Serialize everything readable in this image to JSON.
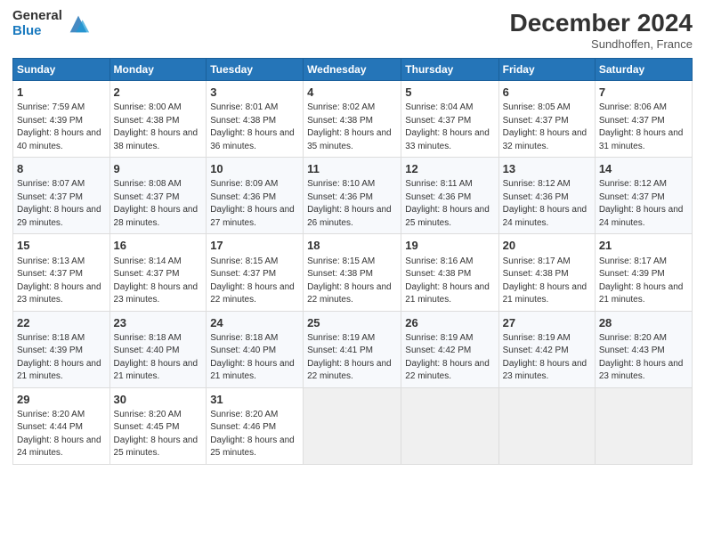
{
  "header": {
    "logo_general": "General",
    "logo_blue": "Blue",
    "month_title": "December 2024",
    "subtitle": "Sundhoffen, France"
  },
  "days_of_week": [
    "Sunday",
    "Monday",
    "Tuesday",
    "Wednesday",
    "Thursday",
    "Friday",
    "Saturday"
  ],
  "weeks": [
    [
      {
        "day": "1",
        "sunrise": "Sunrise: 7:59 AM",
        "sunset": "Sunset: 4:39 PM",
        "daylight": "Daylight: 8 hours and 40 minutes."
      },
      {
        "day": "2",
        "sunrise": "Sunrise: 8:00 AM",
        "sunset": "Sunset: 4:38 PM",
        "daylight": "Daylight: 8 hours and 38 minutes."
      },
      {
        "day": "3",
        "sunrise": "Sunrise: 8:01 AM",
        "sunset": "Sunset: 4:38 PM",
        "daylight": "Daylight: 8 hours and 36 minutes."
      },
      {
        "day": "4",
        "sunrise": "Sunrise: 8:02 AM",
        "sunset": "Sunset: 4:38 PM",
        "daylight": "Daylight: 8 hours and 35 minutes."
      },
      {
        "day": "5",
        "sunrise": "Sunrise: 8:04 AM",
        "sunset": "Sunset: 4:37 PM",
        "daylight": "Daylight: 8 hours and 33 minutes."
      },
      {
        "day": "6",
        "sunrise": "Sunrise: 8:05 AM",
        "sunset": "Sunset: 4:37 PM",
        "daylight": "Daylight: 8 hours and 32 minutes."
      },
      {
        "day": "7",
        "sunrise": "Sunrise: 8:06 AM",
        "sunset": "Sunset: 4:37 PM",
        "daylight": "Daylight: 8 hours and 31 minutes."
      }
    ],
    [
      {
        "day": "8",
        "sunrise": "Sunrise: 8:07 AM",
        "sunset": "Sunset: 4:37 PM",
        "daylight": "Daylight: 8 hours and 29 minutes."
      },
      {
        "day": "9",
        "sunrise": "Sunrise: 8:08 AM",
        "sunset": "Sunset: 4:37 PM",
        "daylight": "Daylight: 8 hours and 28 minutes."
      },
      {
        "day": "10",
        "sunrise": "Sunrise: 8:09 AM",
        "sunset": "Sunset: 4:36 PM",
        "daylight": "Daylight: 8 hours and 27 minutes."
      },
      {
        "day": "11",
        "sunrise": "Sunrise: 8:10 AM",
        "sunset": "Sunset: 4:36 PM",
        "daylight": "Daylight: 8 hours and 26 minutes."
      },
      {
        "day": "12",
        "sunrise": "Sunrise: 8:11 AM",
        "sunset": "Sunset: 4:36 PM",
        "daylight": "Daylight: 8 hours and 25 minutes."
      },
      {
        "day": "13",
        "sunrise": "Sunrise: 8:12 AM",
        "sunset": "Sunset: 4:36 PM",
        "daylight": "Daylight: 8 hours and 24 minutes."
      },
      {
        "day": "14",
        "sunrise": "Sunrise: 8:12 AM",
        "sunset": "Sunset: 4:37 PM",
        "daylight": "Daylight: 8 hours and 24 minutes."
      }
    ],
    [
      {
        "day": "15",
        "sunrise": "Sunrise: 8:13 AM",
        "sunset": "Sunset: 4:37 PM",
        "daylight": "Daylight: 8 hours and 23 minutes."
      },
      {
        "day": "16",
        "sunrise": "Sunrise: 8:14 AM",
        "sunset": "Sunset: 4:37 PM",
        "daylight": "Daylight: 8 hours and 23 minutes."
      },
      {
        "day": "17",
        "sunrise": "Sunrise: 8:15 AM",
        "sunset": "Sunset: 4:37 PM",
        "daylight": "Daylight: 8 hours and 22 minutes."
      },
      {
        "day": "18",
        "sunrise": "Sunrise: 8:15 AM",
        "sunset": "Sunset: 4:38 PM",
        "daylight": "Daylight: 8 hours and 22 minutes."
      },
      {
        "day": "19",
        "sunrise": "Sunrise: 8:16 AM",
        "sunset": "Sunset: 4:38 PM",
        "daylight": "Daylight: 8 hours and 21 minutes."
      },
      {
        "day": "20",
        "sunrise": "Sunrise: 8:17 AM",
        "sunset": "Sunset: 4:38 PM",
        "daylight": "Daylight: 8 hours and 21 minutes."
      },
      {
        "day": "21",
        "sunrise": "Sunrise: 8:17 AM",
        "sunset": "Sunset: 4:39 PM",
        "daylight": "Daylight: 8 hours and 21 minutes."
      }
    ],
    [
      {
        "day": "22",
        "sunrise": "Sunrise: 8:18 AM",
        "sunset": "Sunset: 4:39 PM",
        "daylight": "Daylight: 8 hours and 21 minutes."
      },
      {
        "day": "23",
        "sunrise": "Sunrise: 8:18 AM",
        "sunset": "Sunset: 4:40 PM",
        "daylight": "Daylight: 8 hours and 21 minutes."
      },
      {
        "day": "24",
        "sunrise": "Sunrise: 8:18 AM",
        "sunset": "Sunset: 4:40 PM",
        "daylight": "Daylight: 8 hours and 21 minutes."
      },
      {
        "day": "25",
        "sunrise": "Sunrise: 8:19 AM",
        "sunset": "Sunset: 4:41 PM",
        "daylight": "Daylight: 8 hours and 22 minutes."
      },
      {
        "day": "26",
        "sunrise": "Sunrise: 8:19 AM",
        "sunset": "Sunset: 4:42 PM",
        "daylight": "Daylight: 8 hours and 22 minutes."
      },
      {
        "day": "27",
        "sunrise": "Sunrise: 8:19 AM",
        "sunset": "Sunset: 4:42 PM",
        "daylight": "Daylight: 8 hours and 23 minutes."
      },
      {
        "day": "28",
        "sunrise": "Sunrise: 8:20 AM",
        "sunset": "Sunset: 4:43 PM",
        "daylight": "Daylight: 8 hours and 23 minutes."
      }
    ],
    [
      {
        "day": "29",
        "sunrise": "Sunrise: 8:20 AM",
        "sunset": "Sunset: 4:44 PM",
        "daylight": "Daylight: 8 hours and 24 minutes."
      },
      {
        "day": "30",
        "sunrise": "Sunrise: 8:20 AM",
        "sunset": "Sunset: 4:45 PM",
        "daylight": "Daylight: 8 hours and 25 minutes."
      },
      {
        "day": "31",
        "sunrise": "Sunrise: 8:20 AM",
        "sunset": "Sunset: 4:46 PM",
        "daylight": "Daylight: 8 hours and 25 minutes."
      },
      null,
      null,
      null,
      null
    ]
  ]
}
